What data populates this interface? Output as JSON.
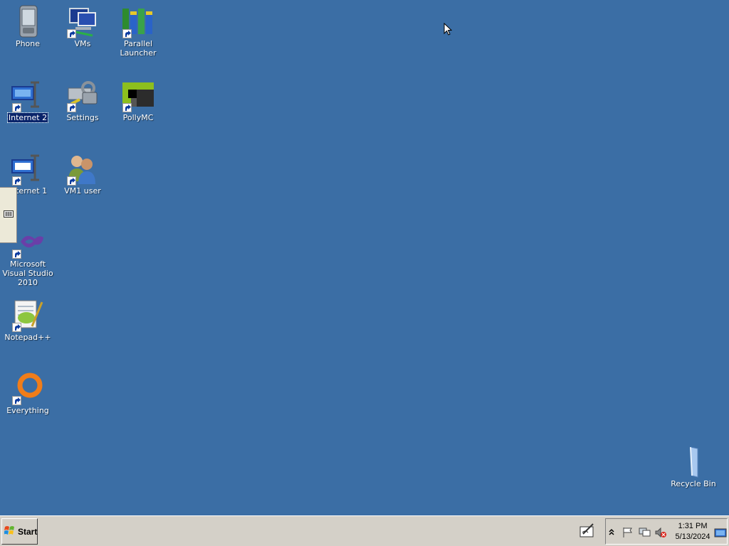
{
  "desktop": {
    "icons": [
      {
        "label": "Phone"
      },
      {
        "label": "VMs"
      },
      {
        "label": "Parallel Launcher"
      },
      {
        "label": "Internet 2"
      },
      {
        "label": "Settings"
      },
      {
        "label": "PollyMC"
      },
      {
        "label": "Internet 1"
      },
      {
        "label": "VM1 user"
      },
      {
        "label": "Microsoft Visual Studio 2010"
      },
      {
        "label": "Notepad++"
      },
      {
        "label": "Everything"
      },
      {
        "label": "Recycle Bin"
      }
    ],
    "background_color": "#3b6ea5",
    "selection_color": "#0a246a"
  },
  "taskbar": {
    "start_label": "Start",
    "clock_time": "1:31 PM",
    "clock_date": "5/13/2024",
    "tray_icons": [
      "chevron-up-icon",
      "flag-icon",
      "network-icon",
      "volume-muted-icon",
      "show-desktop-icon"
    ],
    "quick_launch_icon": "pen-tablet-icon"
  }
}
